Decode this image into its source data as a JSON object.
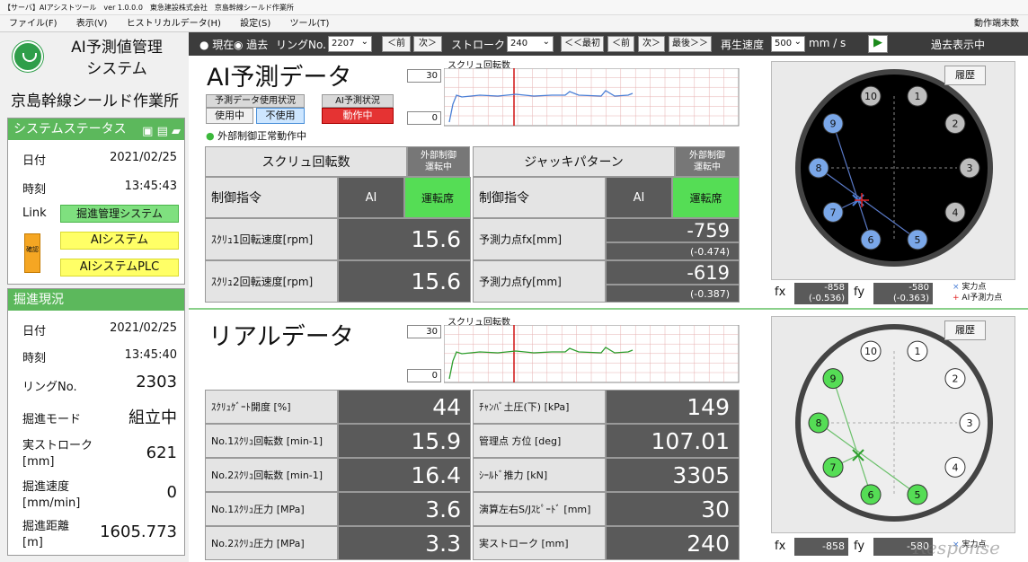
{
  "window": {
    "title": "【サーバ】AIアシストツール　ver 1.0.0.0　東急建設株式会社　京島幹線シールド作業所"
  },
  "menu": {
    "items": [
      "ファイル(F)",
      "表示(V)",
      "ヒストリカルデータ(H)",
      "設定(S)",
      "ツール(T)"
    ],
    "right_label": "動作端末数"
  },
  "sidebar": {
    "app_title_1": "AI予測値管理",
    "app_title_2": "システム",
    "site_name": "京島幹線シールド作業所",
    "status_title": "システムステータス",
    "status": {
      "date_label": "日付",
      "date": "2021/02/25",
      "time_label": "時刻",
      "time": "13:45:43",
      "link_label": "Link",
      "link_1": "掘進管理システム",
      "link_2": "AIシステム",
      "link_3": "AIシステムPLC",
      "box_label": "確認"
    },
    "progress_title": "掘進現況",
    "progress": {
      "date_label": "日付",
      "date": "2021/02/25",
      "time_label": "時刻",
      "time": "13:45:40",
      "ring_label": "リングNo.",
      "ring": "2303",
      "mode_label": "掘進モード",
      "mode": "組立中",
      "stroke_label_1": "実ストローク",
      "stroke_label_2": "[mm]",
      "stroke": "621",
      "speed_label_1": "掘進速度",
      "speed_label_2": "[mm/min]",
      "speed": "0",
      "dist_label_1": "掘進距離",
      "dist_label_2": "[m]",
      "dist": "1605.773"
    }
  },
  "toolbar": {
    "now": "現在",
    "past": "過去",
    "ring_label": "リングNo.",
    "ring_value": "2207",
    "prev": "＜前",
    "next": "次＞",
    "stroke_label": "ストローク",
    "stroke_value": "240",
    "first": "＜＜最初",
    "prev2": "＜前",
    "next2": "次＞",
    "last": "最後＞＞",
    "speed_label": "再生速度",
    "speed_value": "500",
    "speed_unit": "mm / s",
    "status": "過去表示中"
  },
  "ai": {
    "title": "AI予測データ",
    "usage_label": "予測データ使用状況",
    "usage_on": "使用中",
    "usage_off": "不使用",
    "state_label": "AI予測状況",
    "state_value": "動作中",
    "ext_note": "外部制御正常動作中",
    "chart_title": "スクリュ回転数",
    "chart_max": "30",
    "chart_min": "0",
    "screw_header": "スクリュ回転数",
    "ext_header_1": "外部制御",
    "ext_header_2": "運転中",
    "jack_header": "ジャッキパターン",
    "ctrl_label": "制御指令",
    "ai_label": "AI",
    "seat_label": "運転席",
    "screw1_label": "ｽｸﾘｭ1回転速度[rpm]",
    "screw1": "15.6",
    "screw2_label": "ｽｸﾘｭ2回転速度[rpm]",
    "screw2": "15.6",
    "fx_label": "予測力点fx[mm]",
    "fx": "-759",
    "fx_sub": "(-0.474)",
    "fy_label": "予測力点fy[mm]",
    "fy": "-619",
    "fy_sub": "(-0.387)"
  },
  "real": {
    "title": "リアルデータ",
    "chart_title": "スクリュ回転数",
    "chart_max": "30",
    "chart_min": "0",
    "rows_left": [
      {
        "label": "ｽｸﾘｭｹﾞｰﾄ開度 [%]",
        "value": "44"
      },
      {
        "label": "No.1ｽｸﾘｭ回転数 [min-1]",
        "value": "15.9"
      },
      {
        "label": "No.2ｽｸﾘｭ回転数 [min-1]",
        "value": "16.4"
      },
      {
        "label": "No.1ｽｸﾘｭ圧力 [MPa]",
        "value": "3.6"
      },
      {
        "label": "No.2ｽｸﾘｭ圧力 [MPa]",
        "value": "3.3"
      }
    ],
    "rows_right": [
      {
        "label": "ﾁｬﾝﾊﾞ土圧(下) [kPa]",
        "value": "149"
      },
      {
        "label": "管理点 方位 [deg]",
        "value": "107.01"
      },
      {
        "label": "ｼｰﾙﾄﾞ推力 [kN]",
        "value": "3305"
      },
      {
        "label": "演算左右S/Jｽﾋﾟｰﾄﾞ [mm]",
        "value": "30"
      },
      {
        "label": "実ストローク [mm]",
        "value": "240"
      }
    ]
  },
  "map_top": {
    "history": "履歴",
    "fx_label": "fx",
    "fx": "-858",
    "fx_sub": "(-0.536)",
    "fy_label": "fy",
    "fy": "-580",
    "fy_sub": "(-0.363)",
    "legend_actual": "実力点",
    "legend_ai": "AI予測力点"
  },
  "map_bottom": {
    "history": "履歴",
    "fx_label": "fx",
    "fx": "-858",
    "fy_label": "fy",
    "fy": "-580",
    "legend_actual": "実力点"
  },
  "watermark": "Response",
  "colors": {
    "green": "#5cb85c",
    "blue_jack": "#7aa7e8",
    "green_jack": "#55dd55"
  }
}
